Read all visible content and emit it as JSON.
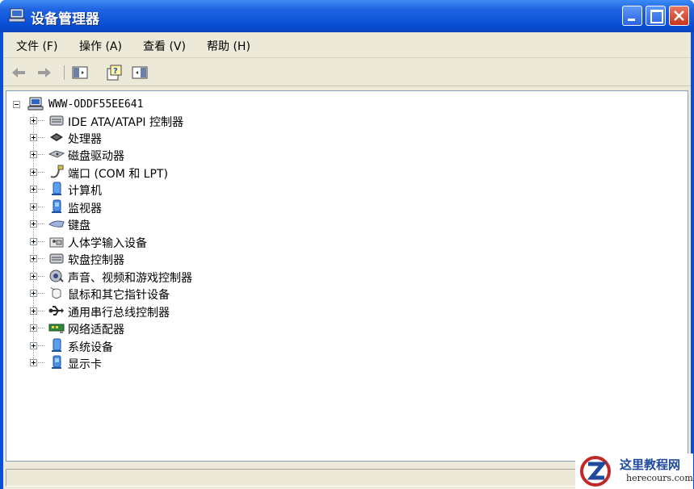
{
  "window": {
    "title": "设备管理器"
  },
  "menu": [
    "文件 (F)",
    "操作 (A)",
    "查看 (V)",
    "帮助 (H)"
  ],
  "toolbar": {
    "items": [
      "back-arrow-icon",
      "forward-arrow-icon",
      "properties-pane-icon",
      "help-icon",
      "details-pane-icon"
    ]
  },
  "tree": {
    "root": {
      "label": "WWW-ODDF55EE641",
      "icon": "computer-icon",
      "expanded": true
    },
    "items": [
      {
        "label": "IDE ATA/ATAPI 控制器",
        "icon": "ide-controller-icon"
      },
      {
        "label": "处理器",
        "icon": "processor-icon"
      },
      {
        "label": "磁盘驱动器",
        "icon": "disk-drive-icon"
      },
      {
        "label": "端口 (COM 和 LPT)",
        "icon": "port-icon"
      },
      {
        "label": "计算机",
        "icon": "computer-monitor-icon"
      },
      {
        "label": "监视器",
        "icon": "monitor-icon"
      },
      {
        "label": "键盘",
        "icon": "keyboard-icon"
      },
      {
        "label": "人体学输入设备",
        "icon": "hid-icon"
      },
      {
        "label": "软盘控制器",
        "icon": "floppy-controller-icon"
      },
      {
        "label": "声音、视频和游戏控制器",
        "icon": "sound-icon"
      },
      {
        "label": "鼠标和其它指针设备",
        "icon": "mouse-icon"
      },
      {
        "label": "通用串行总线控制器",
        "icon": "usb-icon"
      },
      {
        "label": "网络适配器",
        "icon": "network-adapter-icon"
      },
      {
        "label": "系统设备",
        "icon": "system-device-icon"
      },
      {
        "label": "显示卡",
        "icon": "display-adapter-icon"
      }
    ]
  },
  "watermark": {
    "title": "这里教程网",
    "url": "herecours.com"
  },
  "colors": {
    "titlebar": "#0a52d9",
    "client": "#ece9d8",
    "tree_border": "#7f9db9"
  }
}
